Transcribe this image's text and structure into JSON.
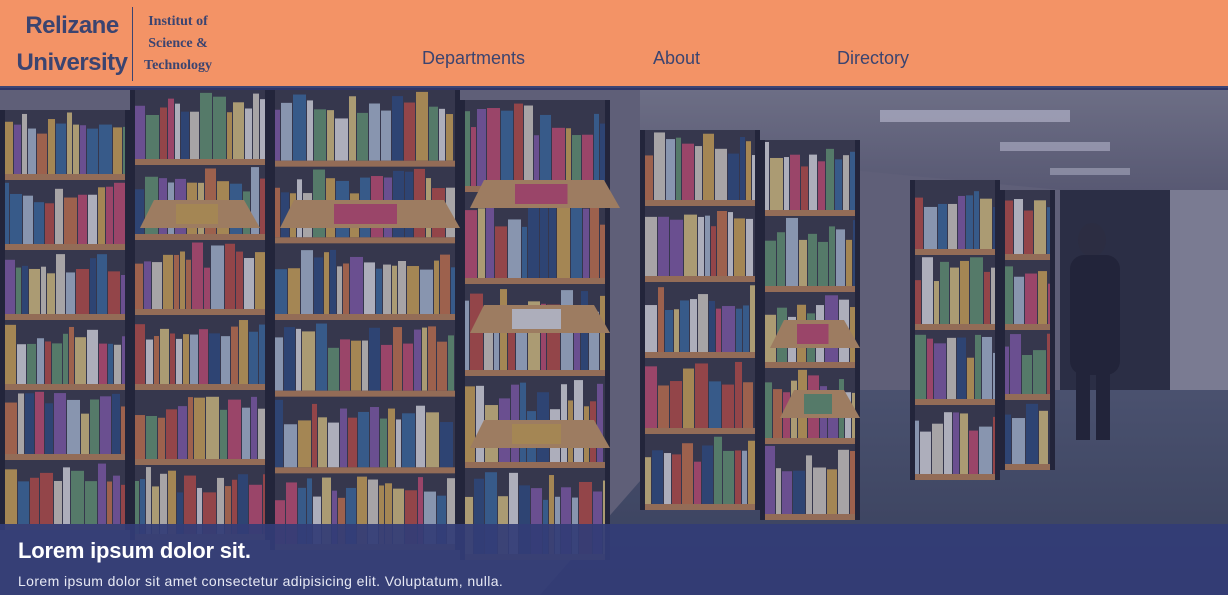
{
  "header": {
    "brand_name": "Relizane University",
    "brand_subtitle": "Institut of Science & Technology",
    "nav": [
      {
        "label": "Departments"
      },
      {
        "label": "About"
      },
      {
        "label": "Directory"
      }
    ]
  },
  "hero": {
    "image_subject": "library-bookshelves-photo"
  },
  "caption": {
    "title": "Lorem ipsum dolor sit.",
    "text": "Lorem ipsum dolor sit amet consectetur adipisicing elit. Voluptatum, nulla."
  },
  "colors": {
    "header_bg": "#f39366",
    "brand_text": "#3b4470",
    "caption_bg": "#333c76",
    "hero_tint": "#2e3566"
  }
}
